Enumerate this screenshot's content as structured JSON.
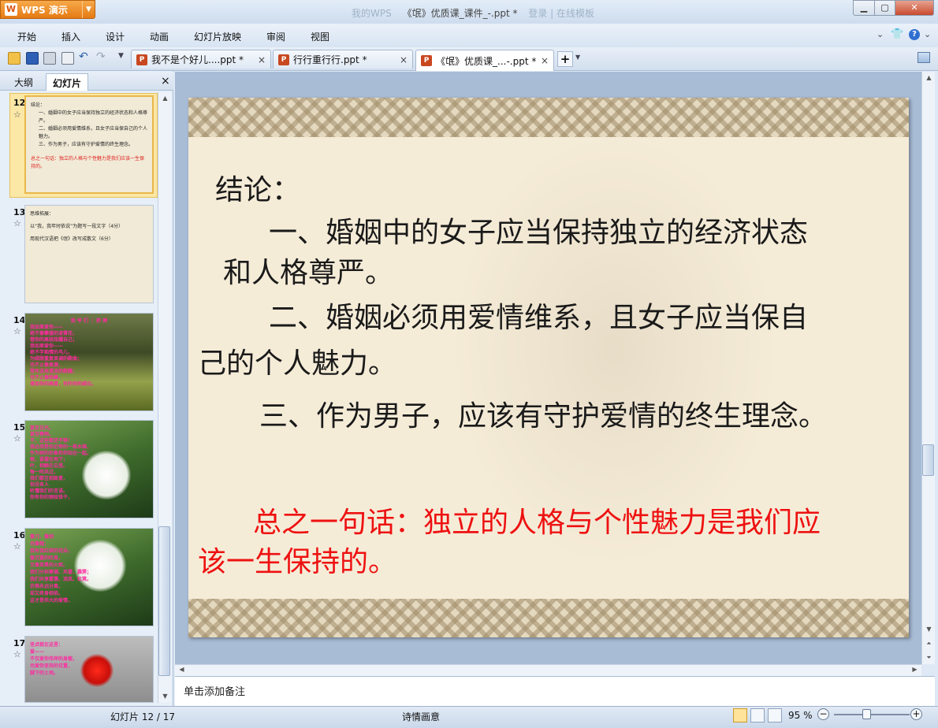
{
  "app": {
    "name": "WPS 演示"
  },
  "window": {
    "title_faded_left": "我的WPS",
    "title": "《氓》优质课_课件_-.ppt *",
    "title_faded_right": "登录  |  在线模板"
  },
  "menu": [
    "开始",
    "插入",
    "设计",
    "动画",
    "幻灯片放映",
    "审阅",
    "视图"
  ],
  "tabs": [
    {
      "label": "我不是个好儿....ppt *",
      "active": false
    },
    {
      "label": "行行重行行.ppt *",
      "active": false
    },
    {
      "label": "《氓》优质课_...-.ppt *",
      "active": true
    }
  ],
  "panel": {
    "tabs": [
      "大纲",
      "幻灯片"
    ],
    "active_tab": "幻灯片",
    "close": "×"
  },
  "thumbnails": [
    {
      "num": "12",
      "lines": [
        "结论：",
        "一、婚姻中的女子应当保持独立的经济状态和人格尊严。",
        "二、婚姻必须用爱情维系，且女子应当保自己的个人魅力。",
        "三、作为男子，应该有守护爱情的终生理念。"
      ],
      "red": "总之一句话：独立的人格与个性魅力是我们应该一生保持的。"
    },
    {
      "num": "13",
      "lines": [
        "思维拓展：",
        "以“我，我年时依说”为题写一段文字（4分）",
        "用现代汉语把《氓》改写成散文（6分）"
      ]
    },
    {
      "num": "14",
      "title": "我 爷 们 ｜ 舒 婷",
      "pink": [
        "我如果爱你——",
        "绝不像攀援的凌霄花，",
        "借你的高枝炫耀自己；",
        "我如果爱你——",
        "绝不学痴情的鸟儿，",
        "为绿荫重复单调的歌曲；",
        "也不止像泉源，",
        "常年送来清凉的慰藉；",
        "也不止像险峰，",
        "增加你的高度，衬托你的威仪。"
      ]
    },
    {
      "num": "15",
      "pink": [
        "甚至日光。",
        "甚至春雨。",
        "不，这些都还不够！",
        "我必须是你近旁的一株木棉，",
        "作为树的形象和你站在一起。",
        "根，紧握在地下；",
        "叶，相触在云里。",
        "每一阵风过，",
        "我们都互相致意，",
        "但没有人",
        "听懂我们的言语。",
        "你有你的铜枝铁干，"
      ]
    },
    {
      "num": "16",
      "pink": [
        "像刀、像剑",
        "也像戟；",
        "我有我红硕的花朵，",
        "像沉重的叹息，",
        "又像英勇的火炬。",
        "我们分担寒潮、风雷、霹雳；",
        "我们共享雾霭、流岚、虹霓。",
        "仿佛永远分离，",
        "却又终身相依。",
        "这才是伟大的爱情，"
      ]
    },
    {
      "num": "17",
      "pink": [
        "坚贞就在这里：",
        "爱——",
        "不仅爱你伟岸的身躯，",
        "也爱你坚持的位置，",
        "脚下的土地。"
      ]
    }
  ],
  "slide": {
    "heading": "结论：",
    "p1a": "一、婚姻中的女子应当保持独立的经济状态",
    "p1b": "和人格尊严。",
    "p2a": "二、婚姻必须用爱情维系，且女子应当保自",
    "p2b": "己的个人魅力。",
    "p3": "三、作为男子，应该有守护爱情的终生理念。",
    "red_a": "总之一句话：独立的人格与个性魅力是我们应",
    "red_b": "该一生保持的。"
  },
  "notes_placeholder": "单击添加备注",
  "status": {
    "slide_info": "幻灯片 12 / 17",
    "theme": "诗情画意",
    "zoom": "95 %"
  },
  "icons": [
    "open-folder-icon",
    "save-icon",
    "print-icon",
    "print-preview-icon",
    "undo-icon",
    "redo-icon",
    "star-icon",
    "help-icon",
    "skin-icon"
  ]
}
